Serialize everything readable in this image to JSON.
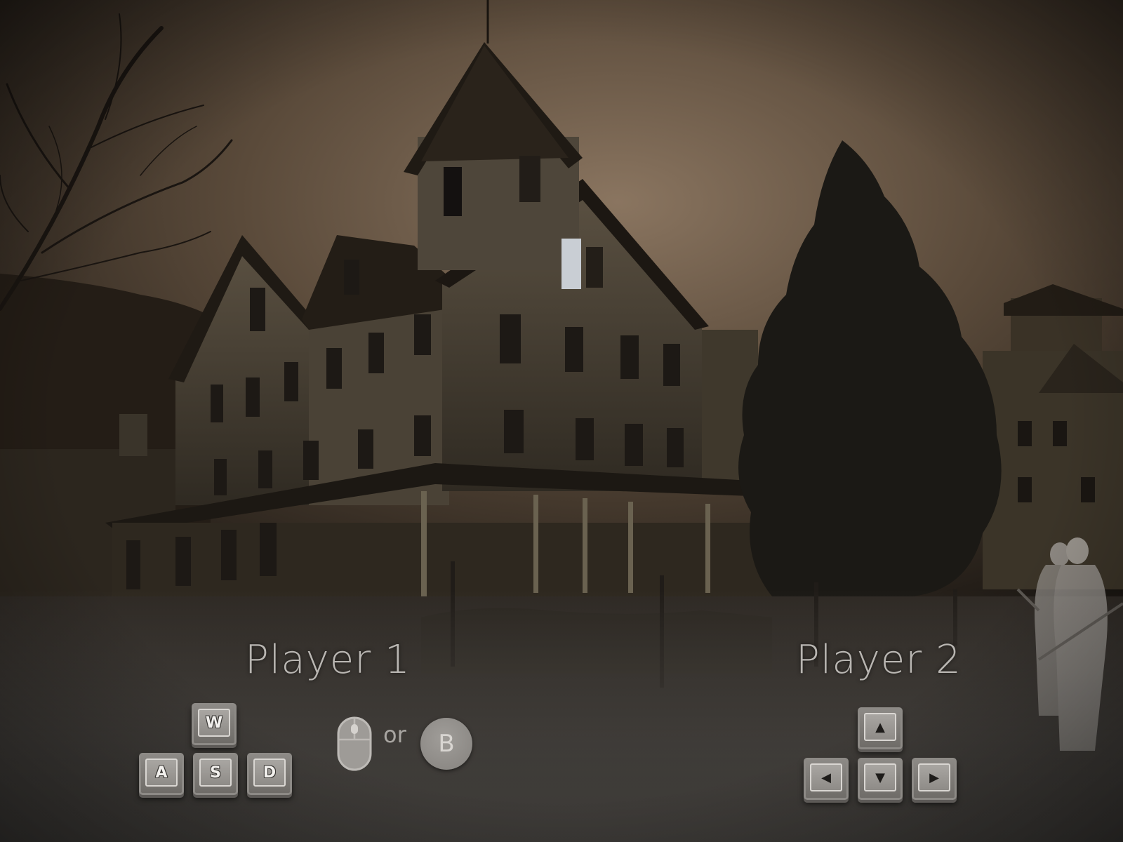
{
  "player1": {
    "label": "Player 1",
    "keys": {
      "up": "W",
      "left": "A",
      "down": "S",
      "right": "D"
    },
    "alt_separator": "or",
    "alt_button": "B"
  },
  "player2": {
    "label": "Player 2",
    "keys": {
      "up": "▲",
      "left": "◀",
      "down": "▼",
      "right": "▶"
    }
  },
  "colors": {
    "sky": "#8a7560",
    "label_text": "#b9b6b2",
    "key_face": "#a9a6a2",
    "house": "#3f382c"
  },
  "icons": {
    "mouse": "mouse-icon",
    "button": "b-button-icon"
  }
}
